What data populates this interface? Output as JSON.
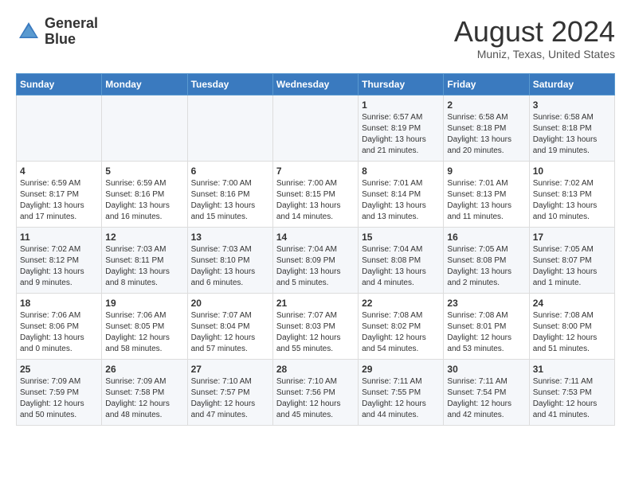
{
  "header": {
    "logo_line1": "General",
    "logo_line2": "Blue",
    "month_title": "August 2024",
    "location": "Muniz, Texas, United States"
  },
  "weekdays": [
    "Sunday",
    "Monday",
    "Tuesday",
    "Wednesday",
    "Thursday",
    "Friday",
    "Saturday"
  ],
  "weeks": [
    [
      {
        "day": "",
        "info": ""
      },
      {
        "day": "",
        "info": ""
      },
      {
        "day": "",
        "info": ""
      },
      {
        "day": "",
        "info": ""
      },
      {
        "day": "1",
        "info": "Sunrise: 6:57 AM\nSunset: 8:19 PM\nDaylight: 13 hours\nand 21 minutes."
      },
      {
        "day": "2",
        "info": "Sunrise: 6:58 AM\nSunset: 8:18 PM\nDaylight: 13 hours\nand 20 minutes."
      },
      {
        "day": "3",
        "info": "Sunrise: 6:58 AM\nSunset: 8:18 PM\nDaylight: 13 hours\nand 19 minutes."
      }
    ],
    [
      {
        "day": "4",
        "info": "Sunrise: 6:59 AM\nSunset: 8:17 PM\nDaylight: 13 hours\nand 17 minutes."
      },
      {
        "day": "5",
        "info": "Sunrise: 6:59 AM\nSunset: 8:16 PM\nDaylight: 13 hours\nand 16 minutes."
      },
      {
        "day": "6",
        "info": "Sunrise: 7:00 AM\nSunset: 8:16 PM\nDaylight: 13 hours\nand 15 minutes."
      },
      {
        "day": "7",
        "info": "Sunrise: 7:00 AM\nSunset: 8:15 PM\nDaylight: 13 hours\nand 14 minutes."
      },
      {
        "day": "8",
        "info": "Sunrise: 7:01 AM\nSunset: 8:14 PM\nDaylight: 13 hours\nand 13 minutes."
      },
      {
        "day": "9",
        "info": "Sunrise: 7:01 AM\nSunset: 8:13 PM\nDaylight: 13 hours\nand 11 minutes."
      },
      {
        "day": "10",
        "info": "Sunrise: 7:02 AM\nSunset: 8:13 PM\nDaylight: 13 hours\nand 10 minutes."
      }
    ],
    [
      {
        "day": "11",
        "info": "Sunrise: 7:02 AM\nSunset: 8:12 PM\nDaylight: 13 hours\nand 9 minutes."
      },
      {
        "day": "12",
        "info": "Sunrise: 7:03 AM\nSunset: 8:11 PM\nDaylight: 13 hours\nand 8 minutes."
      },
      {
        "day": "13",
        "info": "Sunrise: 7:03 AM\nSunset: 8:10 PM\nDaylight: 13 hours\nand 6 minutes."
      },
      {
        "day": "14",
        "info": "Sunrise: 7:04 AM\nSunset: 8:09 PM\nDaylight: 13 hours\nand 5 minutes."
      },
      {
        "day": "15",
        "info": "Sunrise: 7:04 AM\nSunset: 8:08 PM\nDaylight: 13 hours\nand 4 minutes."
      },
      {
        "day": "16",
        "info": "Sunrise: 7:05 AM\nSunset: 8:08 PM\nDaylight: 13 hours\nand 2 minutes."
      },
      {
        "day": "17",
        "info": "Sunrise: 7:05 AM\nSunset: 8:07 PM\nDaylight: 13 hours\nand 1 minute."
      }
    ],
    [
      {
        "day": "18",
        "info": "Sunrise: 7:06 AM\nSunset: 8:06 PM\nDaylight: 13 hours\nand 0 minutes."
      },
      {
        "day": "19",
        "info": "Sunrise: 7:06 AM\nSunset: 8:05 PM\nDaylight: 12 hours\nand 58 minutes."
      },
      {
        "day": "20",
        "info": "Sunrise: 7:07 AM\nSunset: 8:04 PM\nDaylight: 12 hours\nand 57 minutes."
      },
      {
        "day": "21",
        "info": "Sunrise: 7:07 AM\nSunset: 8:03 PM\nDaylight: 12 hours\nand 55 minutes."
      },
      {
        "day": "22",
        "info": "Sunrise: 7:08 AM\nSunset: 8:02 PM\nDaylight: 12 hours\nand 54 minutes."
      },
      {
        "day": "23",
        "info": "Sunrise: 7:08 AM\nSunset: 8:01 PM\nDaylight: 12 hours\nand 53 minutes."
      },
      {
        "day": "24",
        "info": "Sunrise: 7:08 AM\nSunset: 8:00 PM\nDaylight: 12 hours\nand 51 minutes."
      }
    ],
    [
      {
        "day": "25",
        "info": "Sunrise: 7:09 AM\nSunset: 7:59 PM\nDaylight: 12 hours\nand 50 minutes."
      },
      {
        "day": "26",
        "info": "Sunrise: 7:09 AM\nSunset: 7:58 PM\nDaylight: 12 hours\nand 48 minutes."
      },
      {
        "day": "27",
        "info": "Sunrise: 7:10 AM\nSunset: 7:57 PM\nDaylight: 12 hours\nand 47 minutes."
      },
      {
        "day": "28",
        "info": "Sunrise: 7:10 AM\nSunset: 7:56 PM\nDaylight: 12 hours\nand 45 minutes."
      },
      {
        "day": "29",
        "info": "Sunrise: 7:11 AM\nSunset: 7:55 PM\nDaylight: 12 hours\nand 44 minutes."
      },
      {
        "day": "30",
        "info": "Sunrise: 7:11 AM\nSunset: 7:54 PM\nDaylight: 12 hours\nand 42 minutes."
      },
      {
        "day": "31",
        "info": "Sunrise: 7:11 AM\nSunset: 7:53 PM\nDaylight: 12 hours\nand 41 minutes."
      }
    ]
  ]
}
